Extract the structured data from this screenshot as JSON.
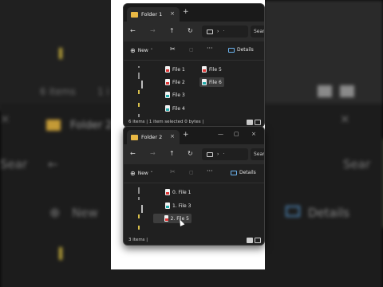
{
  "background": {
    "items_label": "6 items",
    "items_partial": "1 i",
    "folder2_title": "Folder 2",
    "search_left": "Sear",
    "search_right": "Sear",
    "new_label": "New",
    "details_label": "Details"
  },
  "window1": {
    "tab_title": "Folder 1",
    "search_placeholder": "Sear",
    "new_label": "New",
    "details_label": "Details",
    "files": [
      {
        "name": "File 1",
        "color": "#d33"
      },
      {
        "name": "File 2",
        "color": "#d33"
      },
      {
        "name": "File 3",
        "color": "#2aa"
      },
      {
        "name": "File 4",
        "color": "#2aa"
      },
      {
        "name": "File 5",
        "color": "#d33"
      },
      {
        "name": "File 6",
        "color": "#2aa"
      }
    ],
    "status": "6 items  |  1 item selected  0 bytes  |"
  },
  "window2": {
    "tab_title": "Folder 2",
    "search_placeholder": "Sear",
    "new_label": "New",
    "details_label": "Details",
    "files": [
      {
        "name": "0. File 1",
        "color": "#d33"
      },
      {
        "name": "1. File 3",
        "color": "#2aa"
      },
      {
        "name": "2. File 5",
        "color": "#d33"
      }
    ],
    "status": "3 items  |"
  },
  "icons": {
    "folder": "folder-icon",
    "close": "close-icon",
    "add_tab": "plus-icon",
    "back": "arrow-left-icon",
    "forward": "arrow-right-icon",
    "up": "arrow-up-icon",
    "refresh": "refresh-icon",
    "monitor": "monitor-icon",
    "cut": "scissors-icon",
    "more": "more-icon",
    "details": "details-pane-icon",
    "chevron": "chevron-down-icon"
  },
  "colors": {
    "window_bg": "#202020",
    "accent_folder": "#e9b844",
    "details_accent": "#6cb4f0"
  }
}
